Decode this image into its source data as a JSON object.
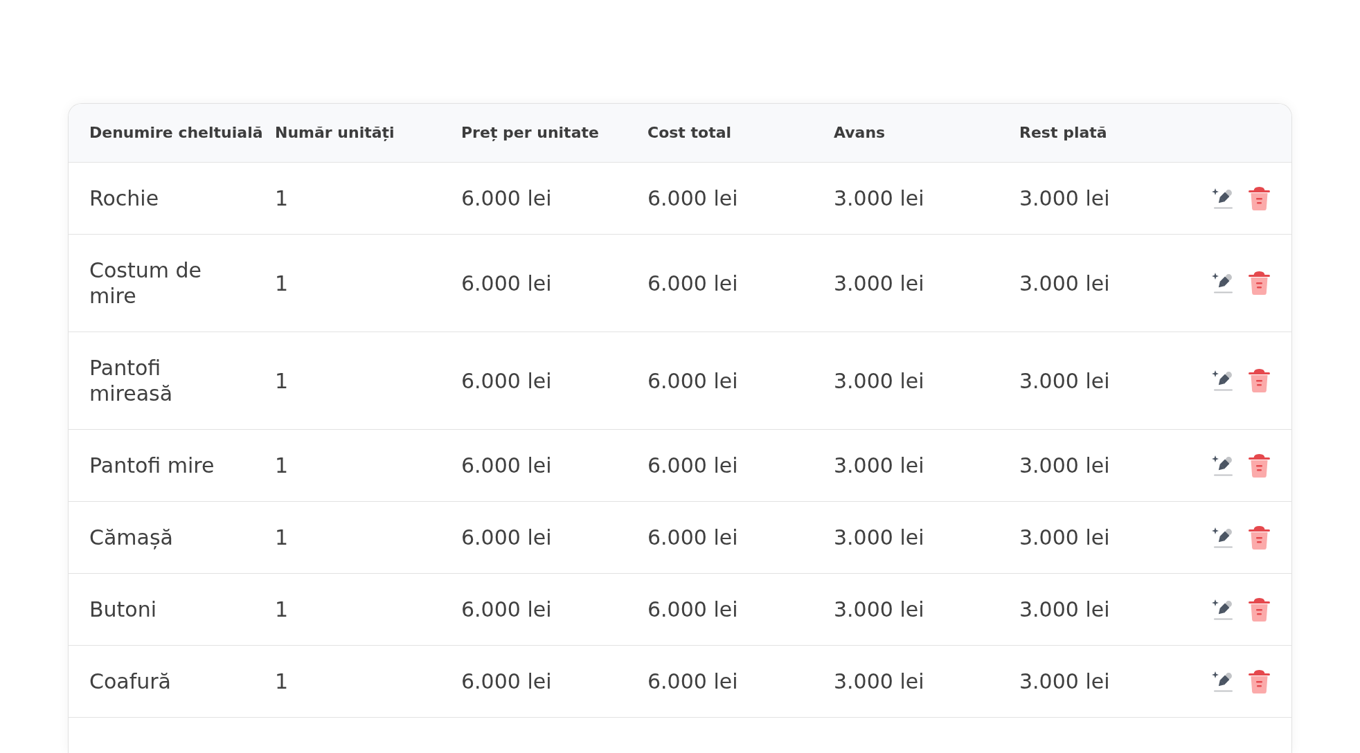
{
  "table": {
    "columns": [
      "Denumire cheltuială",
      "Număr unități",
      "Preț per unitate",
      "Cost total",
      "Avans",
      "Rest plată"
    ],
    "rows": [
      {
        "name": "Rochie",
        "units": "1",
        "unit_price": "6.000 lei",
        "total_cost": "6.000 lei",
        "advance": "3.000 lei",
        "remaining": "3.000 lei"
      },
      {
        "name": "Costum de mire",
        "units": "1",
        "unit_price": "6.000 lei",
        "total_cost": "6.000 lei",
        "advance": "3.000 lei",
        "remaining": "3.000 lei"
      },
      {
        "name": "Pantofi mireasă",
        "units": "1",
        "unit_price": "6.000 lei",
        "total_cost": "6.000 lei",
        "advance": "3.000 lei",
        "remaining": "3.000 lei"
      },
      {
        "name": "Pantofi mire",
        "units": "1",
        "unit_price": "6.000 lei",
        "total_cost": "6.000 lei",
        "advance": "3.000 lei",
        "remaining": "3.000 lei"
      },
      {
        "name": "Cămașă",
        "units": "1",
        "unit_price": "6.000 lei",
        "total_cost": "6.000 lei",
        "advance": "3.000 lei",
        "remaining": "3.000 lei"
      },
      {
        "name": "Butoni",
        "units": "1",
        "unit_price": "6.000 lei",
        "total_cost": "6.000 lei",
        "advance": "3.000 lei",
        "remaining": "3.000 lei"
      },
      {
        "name": "Coafură",
        "units": "1",
        "unit_price": "6.000 lei",
        "total_cost": "6.000 lei",
        "advance": "3.000 lei",
        "remaining": "3.000 lei"
      }
    ]
  }
}
